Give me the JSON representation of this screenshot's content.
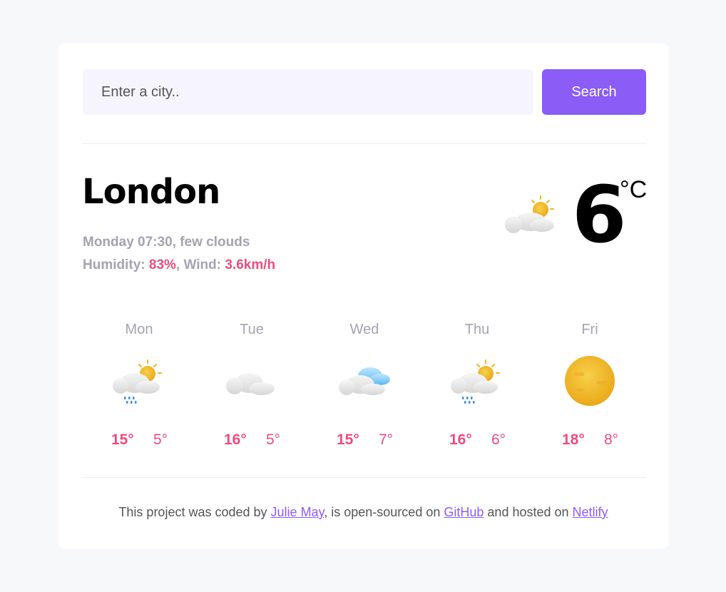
{
  "search": {
    "placeholder": "Enter a city..",
    "button_label": "Search"
  },
  "current": {
    "city": "London",
    "datetime": "Monday 07:30",
    "description": "few clouds",
    "humidity_label": "Humidity:",
    "humidity": "83%",
    "wind_label": "Wind:",
    "wind": "3.6km/h",
    "temperature": "6",
    "unit": "°C",
    "icon": "sun-behind-cloud-icon"
  },
  "forecast": [
    {
      "day": "Mon",
      "max": "15°",
      "min": "5°",
      "icon": "sun-cloud-rain-icon"
    },
    {
      "day": "Tue",
      "max": "16°",
      "min": "5°",
      "icon": "cloud-icon"
    },
    {
      "day": "Wed",
      "max": "15°",
      "min": "7°",
      "icon": "clouds-icon"
    },
    {
      "day": "Thu",
      "max": "16°",
      "min": "6°",
      "icon": "sun-cloud-rain-icon"
    },
    {
      "day": "Fri",
      "max": "18°",
      "min": "8°",
      "icon": "sun-icon"
    }
  ],
  "footer": {
    "text_1": "This project was coded by",
    "author": "Julie May",
    "text_2": ", is open-sourced on",
    "repo": "GitHub",
    "text_3": "and hosted on",
    "host": "Netlify"
  },
  "colors": {
    "accent": "#8b5cf6",
    "highlight": "#ec4d7e",
    "muted": "#a4a4b0",
    "background": "#f7f8fa"
  }
}
